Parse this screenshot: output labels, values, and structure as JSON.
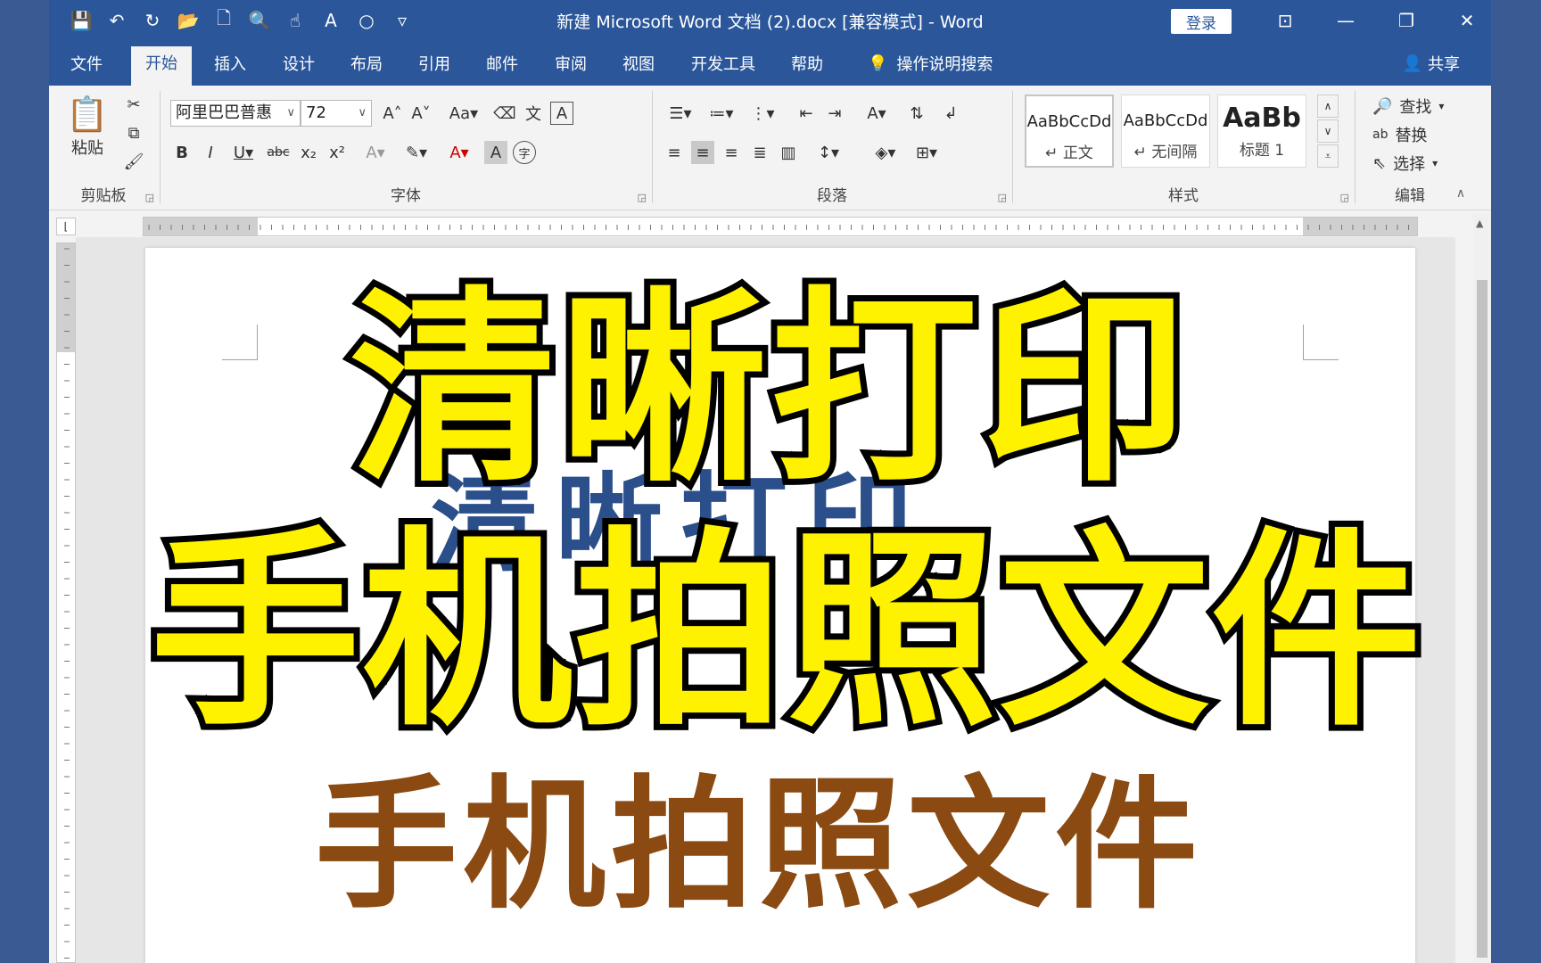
{
  "window": {
    "title": "新建 Microsoft Word 文档 (2).docx [兼容模式]  -  Word",
    "login": "登录"
  },
  "tabs": [
    "文件",
    "开始",
    "插入",
    "设计",
    "布局",
    "引用",
    "邮件",
    "审阅",
    "视图",
    "开发工具",
    "帮助"
  ],
  "active_tab": "开始",
  "tellme": "操作说明搜索",
  "share": "共享",
  "ribbon": {
    "clipboard": {
      "label": "剪贴板",
      "paste": "粘贴"
    },
    "font": {
      "label": "字体",
      "name": "阿里巴巴普惠",
      "size": "72"
    },
    "paragraph": {
      "label": "段落"
    },
    "styles": {
      "label": "样式",
      "items": [
        {
          "sample": "AaBbCcDd",
          "name": "↵ 正文"
        },
        {
          "sample": "AaBbCcDd",
          "name": "↵ 无间隔"
        },
        {
          "sample": "AaBb",
          "name": "标题 1"
        }
      ]
    },
    "editing": {
      "label": "编辑",
      "find": "查找",
      "replace": "替换",
      "select": "选择"
    }
  },
  "document": {
    "ghost": "清晰打印",
    "line": "手机拍照文件"
  },
  "overlay": {
    "line1": "清晰打印",
    "line2": "手机拍照文件"
  },
  "colors": {
    "accent": "#2b579a",
    "overlay_text": "#fff200",
    "doc_text": "#8a4a12"
  }
}
